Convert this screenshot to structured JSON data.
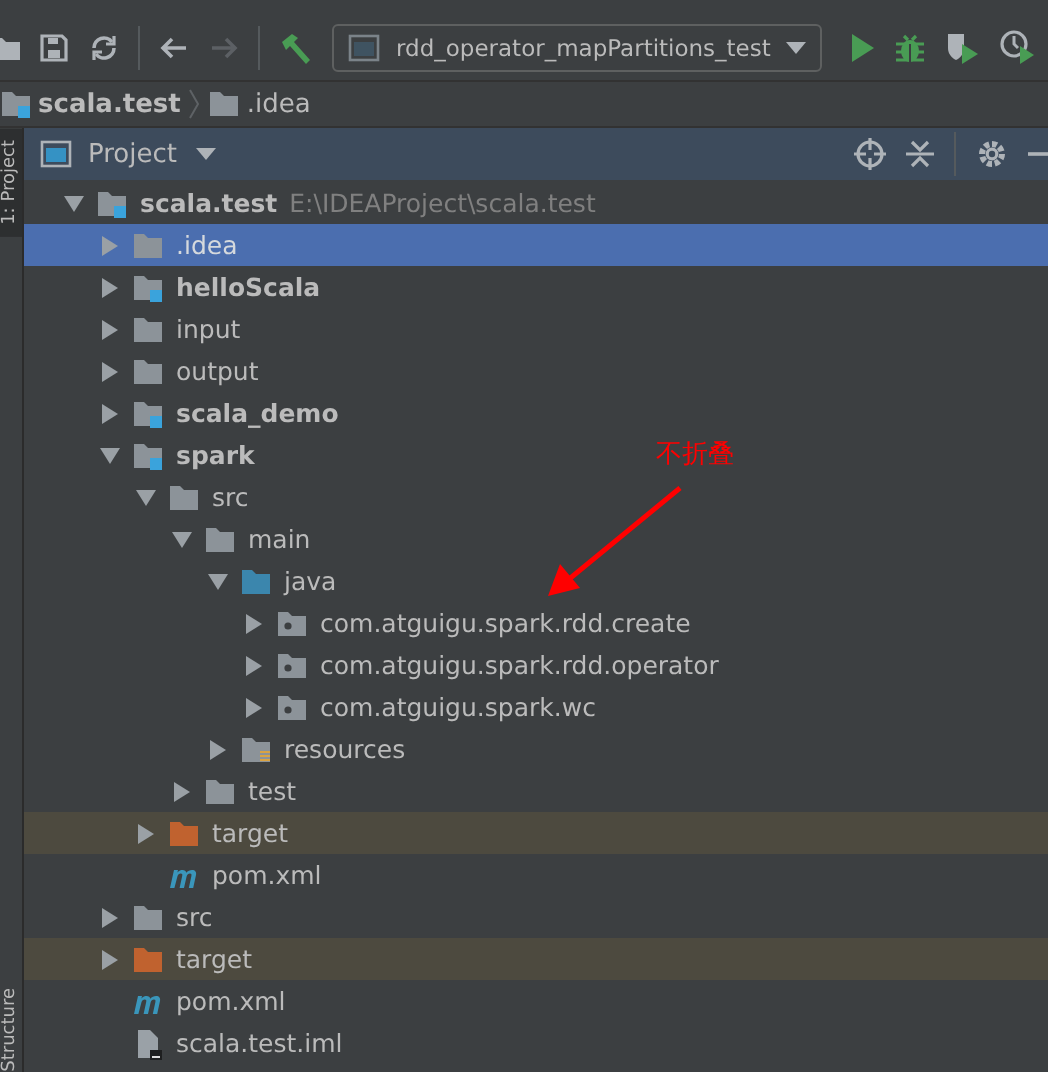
{
  "toolbar": {
    "run_config": "rdd_operator_mapPartitions_test",
    "forward_disabled": true
  },
  "breadcrumb": [
    {
      "label": "scala.test",
      "kind": "module"
    },
    {
      "label": ".idea",
      "kind": "folder"
    }
  ],
  "side_tabs": {
    "top": "1: Project",
    "bottom": "Structure"
  },
  "panel": {
    "title": "Project"
  },
  "tree": [
    {
      "label": "scala.test",
      "hint": "E:\\IDEAProject\\scala.test",
      "kind": "module",
      "expanded": true,
      "selected": false,
      "excluded": false,
      "children": [
        {
          "label": ".idea",
          "kind": "folder",
          "expanded": false,
          "selected": true,
          "excluded": false
        },
        {
          "label": "helloScala",
          "kind": "module",
          "expanded": false,
          "selected": false,
          "excluded": false
        },
        {
          "label": "input",
          "kind": "folder",
          "expanded": false,
          "selected": false,
          "excluded": false
        },
        {
          "label": "output",
          "kind": "folder",
          "expanded": false,
          "selected": false,
          "excluded": false
        },
        {
          "label": "scala_demo",
          "kind": "module",
          "expanded": false,
          "selected": false,
          "excluded": false
        },
        {
          "label": "spark",
          "kind": "module",
          "expanded": true,
          "selected": false,
          "excluded": false,
          "children": [
            {
              "label": "src",
              "kind": "folder",
              "expanded": true,
              "selected": false,
              "excluded": false,
              "children": [
                {
                  "label": "main",
                  "kind": "folder",
                  "expanded": true,
                  "selected": false,
                  "excluded": false,
                  "children": [
                    {
                      "label": "java",
                      "kind": "source",
                      "expanded": true,
                      "selected": false,
                      "excluded": false,
                      "children": [
                        {
                          "label": "com.atguigu.spark.rdd.create",
                          "kind": "package",
                          "expanded": false,
                          "selected": false,
                          "excluded": false
                        },
                        {
                          "label": "com.atguigu.spark.rdd.operator",
                          "kind": "package",
                          "expanded": false,
                          "selected": false,
                          "excluded": false
                        },
                        {
                          "label": "com.atguigu.spark.wc",
                          "kind": "package",
                          "expanded": false,
                          "selected": false,
                          "excluded": false
                        }
                      ]
                    },
                    {
                      "label": "resources",
                      "kind": "resources",
                      "expanded": false,
                      "selected": false,
                      "excluded": false
                    }
                  ]
                },
                {
                  "label": "test",
                  "kind": "folder",
                  "expanded": false,
                  "selected": false,
                  "excluded": false
                }
              ]
            },
            {
              "label": "target",
              "kind": "excluded",
              "expanded": false,
              "selected": false,
              "excluded": true
            },
            {
              "label": "pom.xml",
              "kind": "maven",
              "selected": false,
              "excluded": false
            }
          ]
        },
        {
          "label": "src",
          "kind": "folder",
          "expanded": false,
          "selected": false,
          "excluded": false
        },
        {
          "label": "target",
          "kind": "excluded",
          "expanded": false,
          "selected": false,
          "excluded": true
        },
        {
          "label": "pom.xml",
          "kind": "maven",
          "selected": false,
          "excluded": false
        },
        {
          "label": "scala.test.iml",
          "kind": "iml",
          "selected": false,
          "excluded": false
        }
      ]
    }
  ],
  "annotation": {
    "text": "不折叠"
  }
}
